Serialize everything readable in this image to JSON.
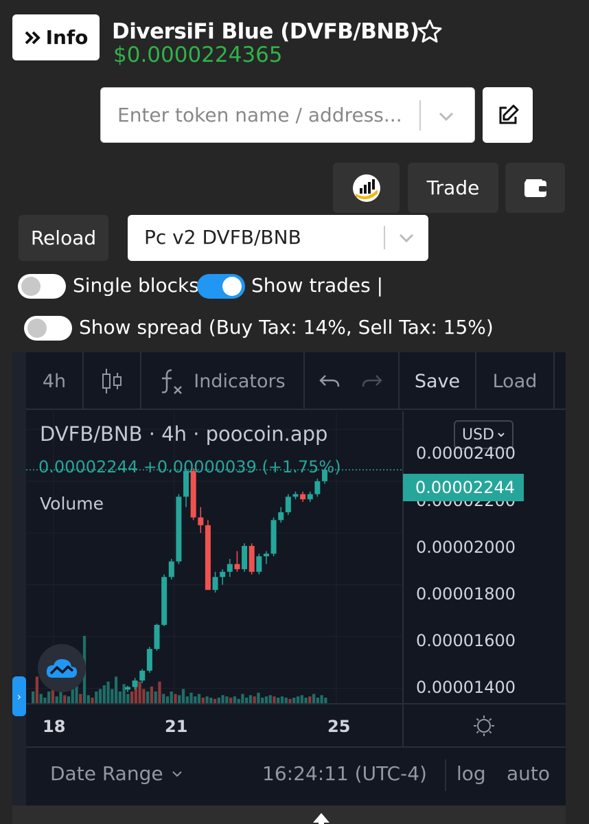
{
  "header": {
    "info_label": "Info",
    "title": "DiversiFi Blue (DVFB/BNB)",
    "price": "$0.0000224365"
  },
  "search": {
    "placeholder": "Enter token name / address..."
  },
  "buttons": {
    "trade": "Trade",
    "reload": "Reload"
  },
  "pair_select": {
    "value": "Pc v2 DVFB/BNB"
  },
  "toggles": {
    "single_blocks": {
      "label": "Single blocks",
      "on": false
    },
    "show_trades": {
      "label": "Show trades |",
      "on": true
    },
    "show_spread": {
      "label": "Show spread (Buy Tax: 14%, Sell Tax: 15%)",
      "on": false
    }
  },
  "toolbar": {
    "interval": "4h",
    "indicators": "Indicators",
    "save": "Save",
    "load": "Load"
  },
  "legend": {
    "title": "DVFB/BNB · 4h · poocoin.app",
    "values": "0.00002244  +0.00000039 (+1.75%)",
    "volume": "Volume",
    "currency": "USD"
  },
  "price_axis": {
    "labels": [
      "0.00002400",
      "0.00002200",
      "0.00002000",
      "0.00001800",
      "0.00001600",
      "0.00001400"
    ],
    "last_price": "0.00002244"
  },
  "time_axis": {
    "labels": [
      "18",
      "21",
      "25"
    ]
  },
  "bottom_bar": {
    "date_range": "Date Range",
    "time": "16:24:11 (UTC-4)",
    "log": "log",
    "auto": "auto"
  },
  "colors": {
    "up": "#26a69a",
    "down": "#ef5350",
    "price_green": "#2fb24a",
    "toggle_on": "#2196f3"
  },
  "chart_data": {
    "type": "candlestick",
    "title": "DVFB/BNB · 4h · poocoin.app",
    "ylim": [
      1.34e-05,
      2.47e-05
    ],
    "candles": [
      {
        "o": 1.395e-05,
        "h": 1.41e-05,
        "l": 1.385e-05,
        "c": 1.405e-05
      },
      {
        "o": 1.405e-05,
        "h": 1.44e-05,
        "l": 1.395e-05,
        "c": 1.43e-05
      },
      {
        "o": 1.43e-05,
        "h": 1.475e-05,
        "l": 1.42e-05,
        "c": 1.468e-05
      },
      {
        "o": 1.468e-05,
        "h": 1.56e-05,
        "l": 1.46e-05,
        "c": 1.552e-05
      },
      {
        "o": 1.552e-05,
        "h": 1.65e-05,
        "l": 1.545e-05,
        "c": 1.645e-05
      },
      {
        "o": 1.645e-05,
        "h": 1.84e-05,
        "l": 1.64e-05,
        "c": 1.83e-05
      },
      {
        "o": 1.83e-05,
        "h": 1.9e-05,
        "l": 1.82e-05,
        "c": 1.89e-05
      },
      {
        "o": 1.89e-05,
        "h": 2.15e-05,
        "l": 1.88e-05,
        "c": 2.14e-05
      },
      {
        "o": 2.14e-05,
        "h": 2.25e-05,
        "l": 2.1e-05,
        "c": 2.24e-05
      },
      {
        "o": 2.24e-05,
        "h": 2.25e-05,
        "l": 2.05e-05,
        "c": 2.06e-05
      },
      {
        "o": 2.06e-05,
        "h": 2.1e-05,
        "l": 2e-05,
        "c": 2.03e-05
      },
      {
        "o": 2.03e-05,
        "h": 2.05e-05,
        "l": 1.78e-05,
        "c": 1.78e-05
      },
      {
        "o": 1.78e-05,
        "h": 1.85e-05,
        "l": 1.77e-05,
        "c": 1.83e-05
      },
      {
        "o": 1.83e-05,
        "h": 1.86e-05,
        "l": 1.8e-05,
        "c": 1.85e-05
      },
      {
        "o": 1.85e-05,
        "h": 1.9e-05,
        "l": 1.83e-05,
        "c": 1.88e-05
      },
      {
        "o": 1.88e-05,
        "h": 1.93e-05,
        "l": 1.85e-05,
        "c": 1.86e-05
      },
      {
        "o": 1.86e-05,
        "h": 1.96e-05,
        "l": 1.85e-05,
        "c": 1.95e-05
      },
      {
        "o": 1.95e-05,
        "h": 1.96e-05,
        "l": 1.84e-05,
        "c": 1.85e-05
      },
      {
        "o": 1.85e-05,
        "h": 1.92e-05,
        "l": 1.84e-05,
        "c": 1.91e-05
      },
      {
        "o": 1.91e-05,
        "h": 1.93e-05,
        "l": 1.88e-05,
        "c": 1.92e-05
      },
      {
        "o": 1.92e-05,
        "h": 2.06e-05,
        "l": 1.91e-05,
        "c": 2.05e-05
      },
      {
        "o": 2.05e-05,
        "h": 2.1e-05,
        "l": 2.04e-05,
        "c": 2.08e-05
      },
      {
        "o": 2.08e-05,
        "h": 2.15e-05,
        "l": 2.07e-05,
        "c": 2.14e-05
      },
      {
        "o": 2.14e-05,
        "h": 2.16e-05,
        "l": 2.13e-05,
        "c": 2.15e-05
      },
      {
        "o": 2.15e-05,
        "h": 2.16e-05,
        "l": 2.12e-05,
        "c": 2.13e-05
      },
      {
        "o": 2.13e-05,
        "h": 2.16e-05,
        "l": 2.12e-05,
        "c": 2.15e-05
      },
      {
        "o": 2.15e-05,
        "h": 2.21e-05,
        "l": 2.14e-05,
        "c": 2.2e-05
      },
      {
        "o": 2.2e-05,
        "h": 2.25e-05,
        "l": 2.19e-05,
        "c": 2.244e-05
      }
    ],
    "volumes": [
      {
        "v": 0.1,
        "up": true
      },
      {
        "v": 0.22,
        "up": false
      },
      {
        "v": 0.08,
        "up": true
      },
      {
        "v": 0.05,
        "up": true
      },
      {
        "v": 0.1,
        "up": true
      },
      {
        "v": 0.25,
        "up": false
      },
      {
        "v": 0.06,
        "up": true
      },
      {
        "v": 0.12,
        "up": true
      },
      {
        "v": 0.07,
        "up": false
      },
      {
        "v": 0.06,
        "up": true
      },
      {
        "v": 0.15,
        "up": true
      },
      {
        "v": 0.18,
        "up": true
      },
      {
        "v": 0.08,
        "up": false
      },
      {
        "v": 0.55,
        "up": true
      },
      {
        "v": 0.07,
        "up": true
      },
      {
        "v": 0.05,
        "up": false
      },
      {
        "v": 0.1,
        "up": true
      },
      {
        "v": 0.12,
        "up": true
      },
      {
        "v": 0.15,
        "up": true
      },
      {
        "v": 0.18,
        "up": true
      },
      {
        "v": 0.12,
        "up": true
      },
      {
        "v": 0.22,
        "up": true
      },
      {
        "v": 0.1,
        "up": true
      },
      {
        "v": 0.16,
        "up": true
      },
      {
        "v": 0.08,
        "up": true
      },
      {
        "v": 0.1,
        "up": false
      },
      {
        "v": 0.14,
        "up": false
      },
      {
        "v": 0.18,
        "up": false
      },
      {
        "v": 0.12,
        "up": false
      },
      {
        "v": 0.1,
        "up": true
      },
      {
        "v": 0.14,
        "up": false
      },
      {
        "v": 0.1,
        "up": true
      },
      {
        "v": 0.18,
        "up": false
      },
      {
        "v": 0.08,
        "up": true
      },
      {
        "v": 0.06,
        "up": true
      },
      {
        "v": 0.1,
        "up": true
      },
      {
        "v": 0.08,
        "up": false
      },
      {
        "v": 0.07,
        "up": true
      },
      {
        "v": 0.12,
        "up": true
      },
      {
        "v": 0.06,
        "up": true
      },
      {
        "v": 0.09,
        "up": true
      },
      {
        "v": 0.06,
        "up": true
      },
      {
        "v": 0.08,
        "up": true
      },
      {
        "v": 0.05,
        "up": false
      },
      {
        "v": 0.06,
        "up": true
      },
      {
        "v": 0.05,
        "up": true
      },
      {
        "v": 0.04,
        "up": false
      },
      {
        "v": 0.05,
        "up": true
      },
      {
        "v": 0.07,
        "up": true
      },
      {
        "v": 0.06,
        "up": true
      },
      {
        "v": 0.05,
        "up": false
      },
      {
        "v": 0.06,
        "up": true
      },
      {
        "v": 0.04,
        "up": true
      },
      {
        "v": 0.08,
        "up": true
      },
      {
        "v": 0.05,
        "up": true
      },
      {
        "v": 0.07,
        "up": true
      },
      {
        "v": 0.06,
        "up": false
      },
      {
        "v": 0.09,
        "up": true
      },
      {
        "v": 0.05,
        "up": true
      },
      {
        "v": 0.06,
        "up": true
      },
      {
        "v": 0.07,
        "up": true
      },
      {
        "v": 0.06,
        "up": false
      },
      {
        "v": 0.05,
        "up": true
      },
      {
        "v": 0.06,
        "up": true
      },
      {
        "v": 0.05,
        "up": true
      },
      {
        "v": 0.04,
        "up": false
      },
      {
        "v": 0.05,
        "up": true
      },
      {
        "v": 0.06,
        "up": true
      },
      {
        "v": 0.07,
        "up": true
      },
      {
        "v": 0.05,
        "up": true
      },
      {
        "v": 0.06,
        "up": false
      },
      {
        "v": 0.08,
        "up": true
      },
      {
        "v": 0.05,
        "up": true
      },
      {
        "v": 0.07,
        "up": true
      },
      {
        "v": 0.05,
        "up": true
      }
    ]
  }
}
